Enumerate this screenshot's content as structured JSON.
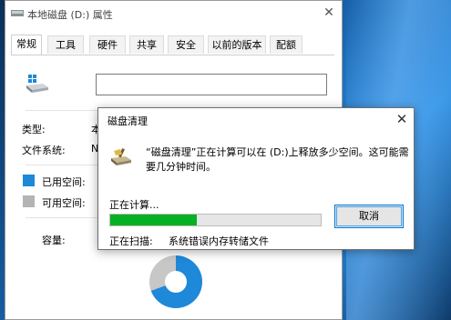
{
  "properties_window": {
    "title": "本地磁盘 (D:) 属性",
    "tabs": [
      {
        "label": "常规",
        "active": true
      },
      {
        "label": "工具"
      },
      {
        "label": "硬件"
      },
      {
        "label": "共享"
      },
      {
        "label": "安全"
      },
      {
        "label": "以前的版本"
      },
      {
        "label": "配额"
      }
    ],
    "drive_name_value": "",
    "type_label": "类型:",
    "type_value_partial": "本",
    "filesystem_label": "文件系统:",
    "filesystem_value_partial": "N",
    "used_space_label": "已用空间:",
    "free_space_label": "可用空间:",
    "capacity_label": "容量:",
    "used_color": "#1e88d9",
    "free_color": "#b4b4b4",
    "drive_icon": "hard-drive-icon"
  },
  "disk_cleanup_dialog": {
    "title": "磁盘清理",
    "message": "“磁盘清理”正在计算可以在 (D:)上释放多少空间。这可能需要几分钟时间。",
    "calculating_label": "正在计算...",
    "progress_fraction": 0.41,
    "progress_color": "#06b025",
    "cancel_label": "取消",
    "scanning_label": "正在扫描:",
    "scanning_item": "系统错误内存转储文件",
    "icon": "disk-cleanup-icon"
  }
}
